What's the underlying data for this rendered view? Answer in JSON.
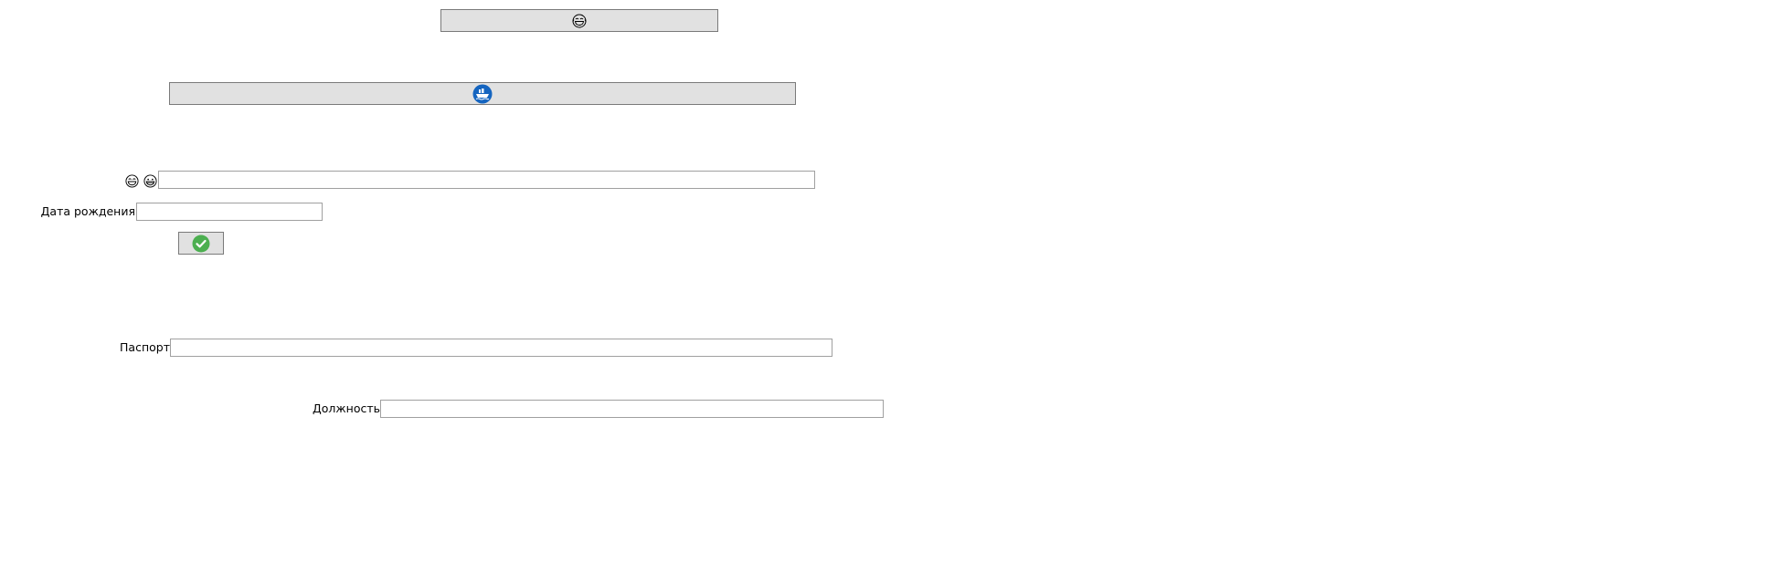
{
  "top_button": {
    "icon": "laughing-face-icon"
  },
  "ship_button": {
    "icon": "ship-icon",
    "icon_color": "#1565c0"
  },
  "name_row": {
    "icons": [
      "laughing-face-icon",
      "grinning-face-icon"
    ],
    "value": ""
  },
  "birth_date": {
    "label": "Дата рождения",
    "value": ""
  },
  "confirm_button": {
    "icon": "checkmark-icon",
    "icon_color": "#4caf50"
  },
  "passport": {
    "label": "Паспорт",
    "value": ""
  },
  "position": {
    "label": "Должность",
    "value": ""
  }
}
